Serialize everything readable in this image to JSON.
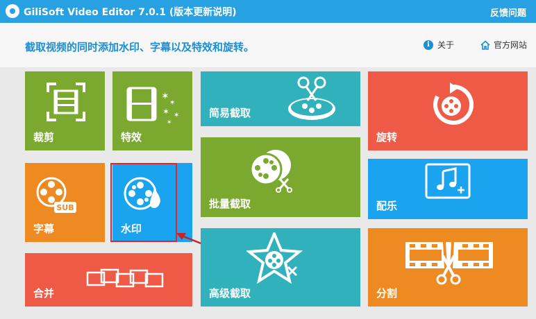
{
  "app": {
    "title": "GiliSoft Video Editor 7.0.1 (版本更新说明)",
    "feedback": "反馈问题"
  },
  "header": {
    "tagline": "截取视频的同时添加水印、字幕以及特效和旋转。",
    "about": "关于",
    "website": "官方网站"
  },
  "tiles": {
    "crop": "裁剪",
    "effects": "特效",
    "subtitle": "字幕",
    "subtitle_badge": "SUB",
    "watermark": "水印",
    "merge": "合并",
    "simple_cut": "简易截取",
    "batch_cut": "批量截取",
    "advanced_cut": "高级截取",
    "rotate": "旋转",
    "music": "配乐",
    "split": "分割"
  },
  "colors": {
    "titlebar": "#27a1e1",
    "green": "#7ba92f",
    "teal": "#30b1bb",
    "red": "#ee5a45",
    "blue": "#1aa3ee",
    "orange": "#ee8a22",
    "highlight": "#e0252e"
  },
  "selected_tile": "watermark"
}
